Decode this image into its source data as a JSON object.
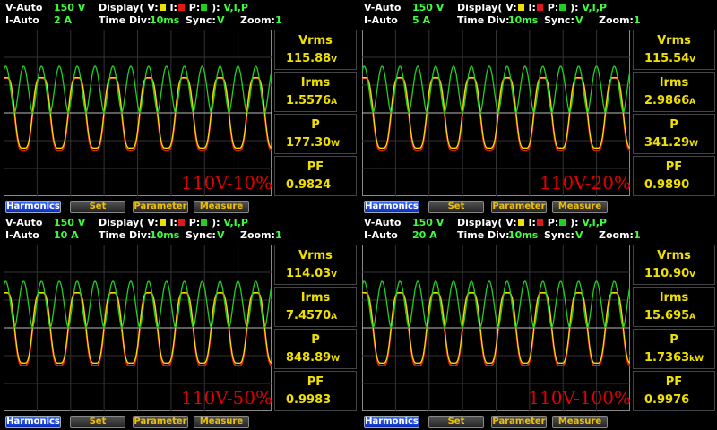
{
  "colors": {
    "voltage": "#f0e000",
    "current": "#e01818",
    "power": "#20d020",
    "value_text": "#3cff3c",
    "label_text": "#ffffff",
    "overlay_label": "#e00000",
    "harmonics_button": "#2050e0"
  },
  "panels": [
    {
      "header": {
        "v_auto_label": "V-Auto",
        "v_range": "150 V",
        "i_auto_label": "I-Auto",
        "i_range": "2 A",
        "display_label": "Display( V:",
        "display_i": " I:",
        "display_p": " P:",
        "display_end": " ):",
        "display_value": "V,I,P",
        "timediv_label": "Time Div:",
        "timediv_value": "10ms",
        "sync_label": "Sync:",
        "sync_value": "V",
        "zoom_label": "Zoom:",
        "zoom_value": "1"
      },
      "measurements": [
        {
          "label": "Vrms",
          "value": "115.88",
          "unit": "V"
        },
        {
          "label": "Irms",
          "value": "1.5576",
          "unit": "A"
        },
        {
          "label": "P",
          "value": "177.30",
          "unit": "W"
        },
        {
          "label": "PF",
          "value": "0.9824",
          "unit": ""
        }
      ],
      "overlay_label": "110V-10%",
      "buttons": [
        "Harmonics",
        "Set",
        "Parameter",
        "Measure"
      ]
    },
    {
      "header": {
        "v_auto_label": "V-Auto",
        "v_range": "150 V",
        "i_auto_label": "I-Auto",
        "i_range": "5 A",
        "display_label": "Display( V:",
        "display_i": " I:",
        "display_p": " P:",
        "display_end": " ):",
        "display_value": "V,I,P",
        "timediv_label": "Time Div:",
        "timediv_value": "10ms",
        "sync_label": "Sync:",
        "sync_value": "V",
        "zoom_label": "Zoom:",
        "zoom_value": "1"
      },
      "measurements": [
        {
          "label": "Vrms",
          "value": "115.54",
          "unit": "V"
        },
        {
          "label": "Irms",
          "value": "2.9866",
          "unit": "A"
        },
        {
          "label": "P",
          "value": "341.29",
          "unit": "W"
        },
        {
          "label": "PF",
          "value": "0.9890",
          "unit": ""
        }
      ],
      "overlay_label": "110V-20%",
      "buttons": [
        "Harmonics",
        "Set",
        "Parameter",
        "Measure"
      ]
    },
    {
      "header": {
        "v_auto_label": "V-Auto",
        "v_range": "150 V",
        "i_auto_label": "I-Auto",
        "i_range": "10 A",
        "display_label": "Display( V:",
        "display_i": " I:",
        "display_p": " P:",
        "display_end": " ):",
        "display_value": "V,I,P",
        "timediv_label": "Time Div:",
        "timediv_value": "10ms",
        "sync_label": "Sync:",
        "sync_value": "V",
        "zoom_label": "Zoom:",
        "zoom_value": "1"
      },
      "measurements": [
        {
          "label": "Vrms",
          "value": "114.03",
          "unit": "V"
        },
        {
          "label": "Irms",
          "value": "7.4570",
          "unit": "A"
        },
        {
          "label": "P",
          "value": "848.89",
          "unit": "W"
        },
        {
          "label": "PF",
          "value": "0.9983",
          "unit": ""
        }
      ],
      "overlay_label": "110V-50%",
      "buttons": [
        "Harmonics",
        "Set",
        "Parameter",
        "Measure"
      ]
    },
    {
      "header": {
        "v_auto_label": "V-Auto",
        "v_range": "150 V",
        "i_auto_label": "I-Auto",
        "i_range": "20 A",
        "display_label": "Display( V:",
        "display_i": " I:",
        "display_p": " P:",
        "display_end": " ):",
        "display_value": "V,I,P",
        "timediv_label": "Time Div:",
        "timediv_value": "10ms",
        "sync_label": "Sync:",
        "sync_value": "V",
        "zoom_label": "Zoom:",
        "zoom_value": "1"
      },
      "measurements": [
        {
          "label": "Vrms",
          "value": "110.90",
          "unit": "V"
        },
        {
          "label": "Irms",
          "value": "15.695",
          "unit": "A"
        },
        {
          "label": "P",
          "value": "1.7363",
          "unit": "kW"
        },
        {
          "label": "PF",
          "value": "0.9976",
          "unit": ""
        }
      ],
      "overlay_label": "110V-100%",
      "buttons": [
        "Harmonics",
        "Set",
        "Parameter",
        "Measure"
      ]
    }
  ],
  "waveform": {
    "cycles_on_screen": 7.5,
    "voltage_amplitude_fraction": 0.24,
    "power_amplitude_fraction": 0.28
  }
}
